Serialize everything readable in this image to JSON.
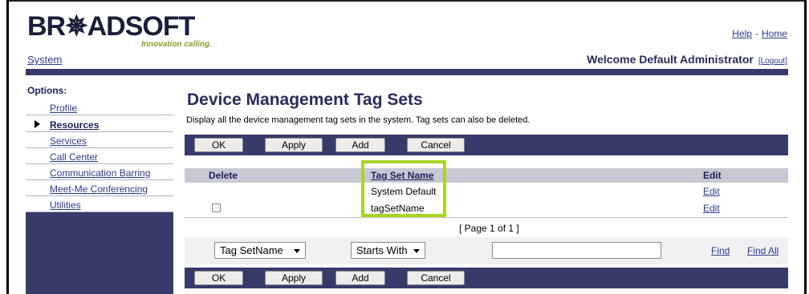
{
  "header": {
    "logo_text": "BR✵ADSOFT",
    "tagline": "Innovation calling.",
    "help_link": "Help",
    "separator": "-",
    "home_link": "Home",
    "system_link": "System",
    "welcome_text": "Welcome Default Administrator",
    "logout_link": "[Logout]"
  },
  "sidebar": {
    "title": "Options:",
    "items": [
      {
        "label": "Profile",
        "active": false
      },
      {
        "label": "Resources",
        "active": true
      },
      {
        "label": "Services",
        "active": false
      },
      {
        "label": "Call Center",
        "active": false
      },
      {
        "label": "Communication Barring",
        "active": false
      },
      {
        "label": "Meet-Me Conferencing",
        "active": false
      },
      {
        "label": "Utilities",
        "active": false
      }
    ]
  },
  "main": {
    "title": "Device Management Tag Sets",
    "description": "Display all the device management tag sets in the system. Tag sets can also be deleted.",
    "buttons": {
      "ok": "OK",
      "apply": "Apply",
      "add": "Add",
      "cancel": "Cancel"
    },
    "table": {
      "columns": {
        "delete": "Delete",
        "name": "Tag Set Name",
        "edit": "Edit"
      },
      "rows": [
        {
          "name": "System Default",
          "edit": "Edit",
          "has_checkbox": false
        },
        {
          "name": "tagSetName",
          "edit": "Edit",
          "has_checkbox": true
        }
      ]
    },
    "pager": "[ Page 1 of 1 ]",
    "search": {
      "field_select": "Tag SetName",
      "mode_select": "Starts With",
      "input_value": "",
      "find_link": "Find",
      "find_all_link": "Find All"
    }
  },
  "colors": {
    "nav_bar": "#373b6a",
    "highlight": "#a8d42a",
    "link": "#2e3a8c"
  }
}
